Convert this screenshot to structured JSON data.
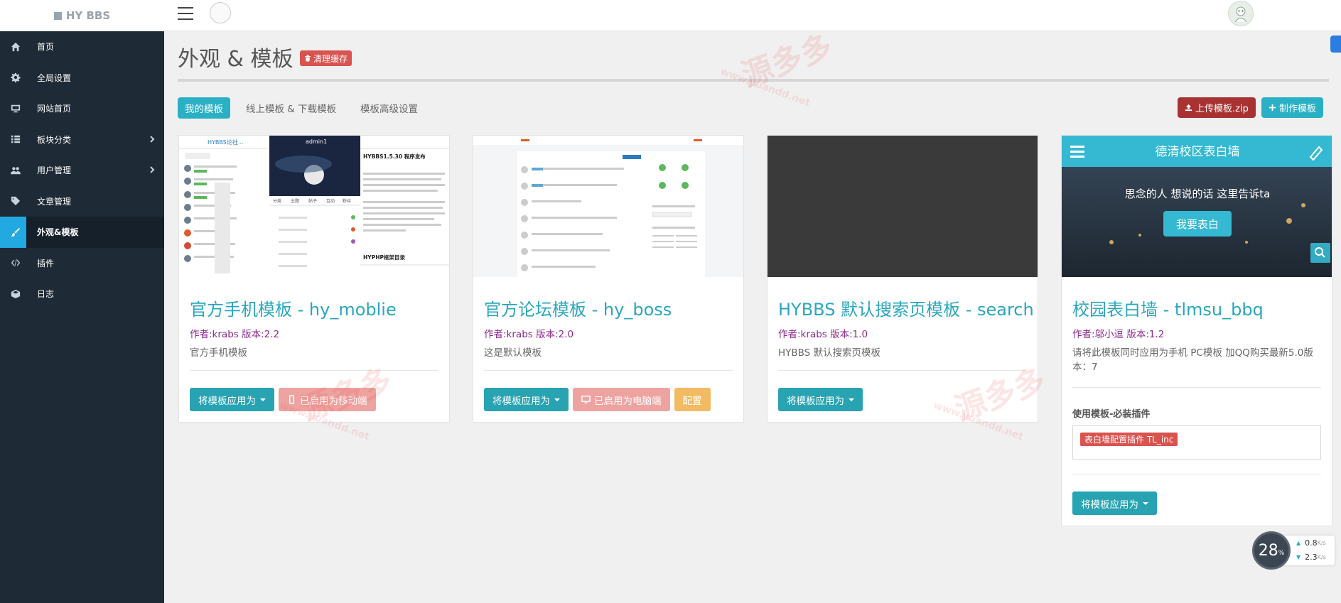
{
  "brand": "HY BBS",
  "sidebar": {
    "items": [
      {
        "label": "首页",
        "icon": "home-icon"
      },
      {
        "label": "全局设置",
        "icon": "gear-icon"
      },
      {
        "label": "网站首页",
        "icon": "monitor-icon"
      },
      {
        "label": "板块分类",
        "icon": "list-icon",
        "has_children": true
      },
      {
        "label": "用户管理",
        "icon": "users-icon",
        "has_children": true
      },
      {
        "label": "文章管理",
        "icon": "tag-icon"
      },
      {
        "label": "外观&模板",
        "icon": "brush-icon",
        "active": true
      },
      {
        "label": "插件",
        "icon": "code-icon"
      },
      {
        "label": "日志",
        "icon": "cube-icon"
      }
    ]
  },
  "page": {
    "title": "外观 & 模板",
    "clear_cache": "清理缓存"
  },
  "tabs": [
    "我的模板",
    "线上模板 & 下载模板",
    "模板高级设置"
  ],
  "actions": {
    "upload": "上传模板.zip",
    "make": "制作模板"
  },
  "cards": [
    {
      "title": "官方手机模板 - hy_moblie",
      "meta": "作者:krabs 版本:2.2",
      "desc": "官方手机模板",
      "apply": "将模板应用为",
      "status": "已启用为移动端"
    },
    {
      "title": "官方论坛模板 - hy_boss",
      "meta": "作者:krabs 版本:2.0",
      "desc": "这是默认模板",
      "apply": "将模板应用为",
      "status": "已启用为电脑端",
      "config": "配置"
    },
    {
      "title": "HYBBS 默认搜索页模板 - search",
      "meta": "作者:krabs 版本:1.0",
      "desc": "HYBBS 默认搜索页模板",
      "apply": "将模板应用为"
    },
    {
      "title": "校园表白墙 - tlmsu_bbq",
      "meta": "作者:邬小逗 版本:1.2",
      "desc": "请将此模板同时应用为手机 PC模板 加QQ购买最新5.0版本：7",
      "apply": "将模板应用为",
      "plugins_label": "使用模板-必装插件",
      "plugin_tag": "表白墙配置插件 TL_inc",
      "preview": {
        "header": "德清校区表白墙",
        "slogan": "思念的人 想说的话 这里告诉ta",
        "button": "我要表白"
      }
    }
  ],
  "thumb_texts": {
    "mobile_title": "HYBBS论社...",
    "mobile_user": "admin1",
    "mobile_post": "HYBBS1.5.30 程序发布",
    "mobile_toc": "HYPHP框架目录",
    "mobile_tabs": [
      "分类",
      "主题",
      "帖子",
      "互动",
      "粉丝"
    ]
  },
  "speed": {
    "percent": "28",
    "percent_unit": "%",
    "up": "0.8",
    "down": "2.3",
    "unit": "K/s"
  },
  "watermark": {
    "logo": "源多多",
    "url": "www.yuandd.net"
  },
  "colors": {
    "sidebar_bg": "#1e2a36",
    "accent": "#2ab0c5",
    "danger": "#d9534f",
    "title_link": "#2aa6bd"
  }
}
